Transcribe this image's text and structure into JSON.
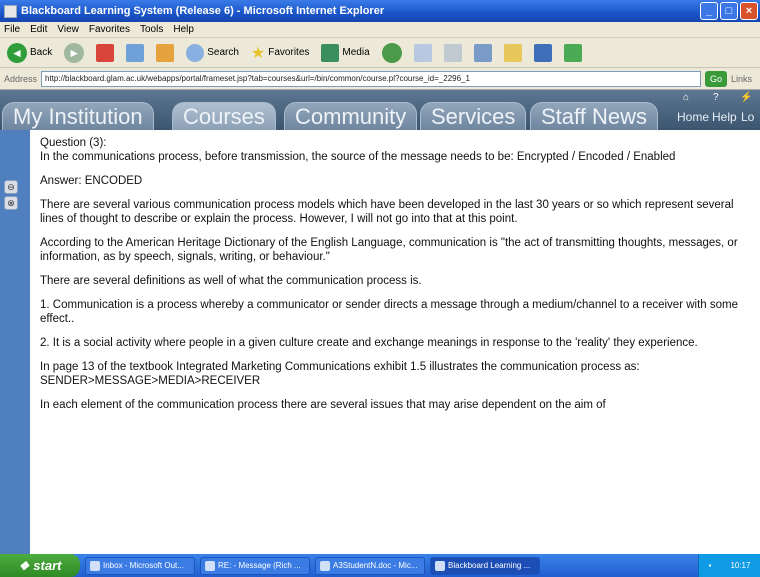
{
  "window": {
    "title": "Blackboard Learning System (Release 6) - Microsoft Internet Explorer",
    "min": "_",
    "max": "□",
    "close": "×"
  },
  "menu": [
    "File",
    "Edit",
    "View",
    "Favorites",
    "Tools",
    "Help"
  ],
  "toolbar": {
    "back": "Back",
    "search": "Search",
    "favorites": "Favorites",
    "media": "Media"
  },
  "address": {
    "label": "Address",
    "url": "http://blackboard.glam.ac.uk/webapps/portal/frameset.jsp?tab=courses&url=/bin/common/course.pl?course_id=_2296_1",
    "go": "Go",
    "links": "Links"
  },
  "bb": {
    "tabs": [
      "My Institution",
      "Courses",
      "Community",
      "Services",
      "Staff News"
    ],
    "active_tab": "Courses",
    "home": "Home",
    "help": "Help",
    "logout": "Lo"
  },
  "content": {
    "question_label": "Question (3):",
    "question_text": "In the communications process, before transmission, the source of the message needs to be: Encrypted / Encoded / Enabled",
    "answer": "Answer: ENCODED",
    "p1": "There are several various communication process models which have been developed in the last 30 years or so which represent several lines of thought to describe or explain the process. However, I will not go into that at this point.",
    "p2": "According to the American Heritage Dictionary of the English Language, communication is \"the act of transmitting thoughts, messages, or information, as by speech, signals, writing, or behaviour.\"",
    "p3": "There are several definitions as well of what the communication process is.",
    "p4": "1. Communication is a process whereby a communicator or sender directs a message through a medium/channel to a receiver with some effect..",
    "p5": "2. It is a social activity where people in a given culture create and exchange meanings in response to the 'reality' they experience.",
    "p6a": "In page 13 of the textbook Integrated Marketing Communications exhibit 1.5 illustrates the communication process as:",
    "p6b": "SENDER>MESSAGE>MEDIA>RECEIVER",
    "p7": "In each element of the communication process there are several issues that may arise dependent on the aim of"
  },
  "taskbar": {
    "start": "start",
    "tasks": [
      "Inbox - Microsoft Out...",
      "RE: - Message (Rich ...",
      "A3StudentN.doc - Mic...",
      "Blackboard Learning ..."
    ],
    "tray": "10:17"
  }
}
